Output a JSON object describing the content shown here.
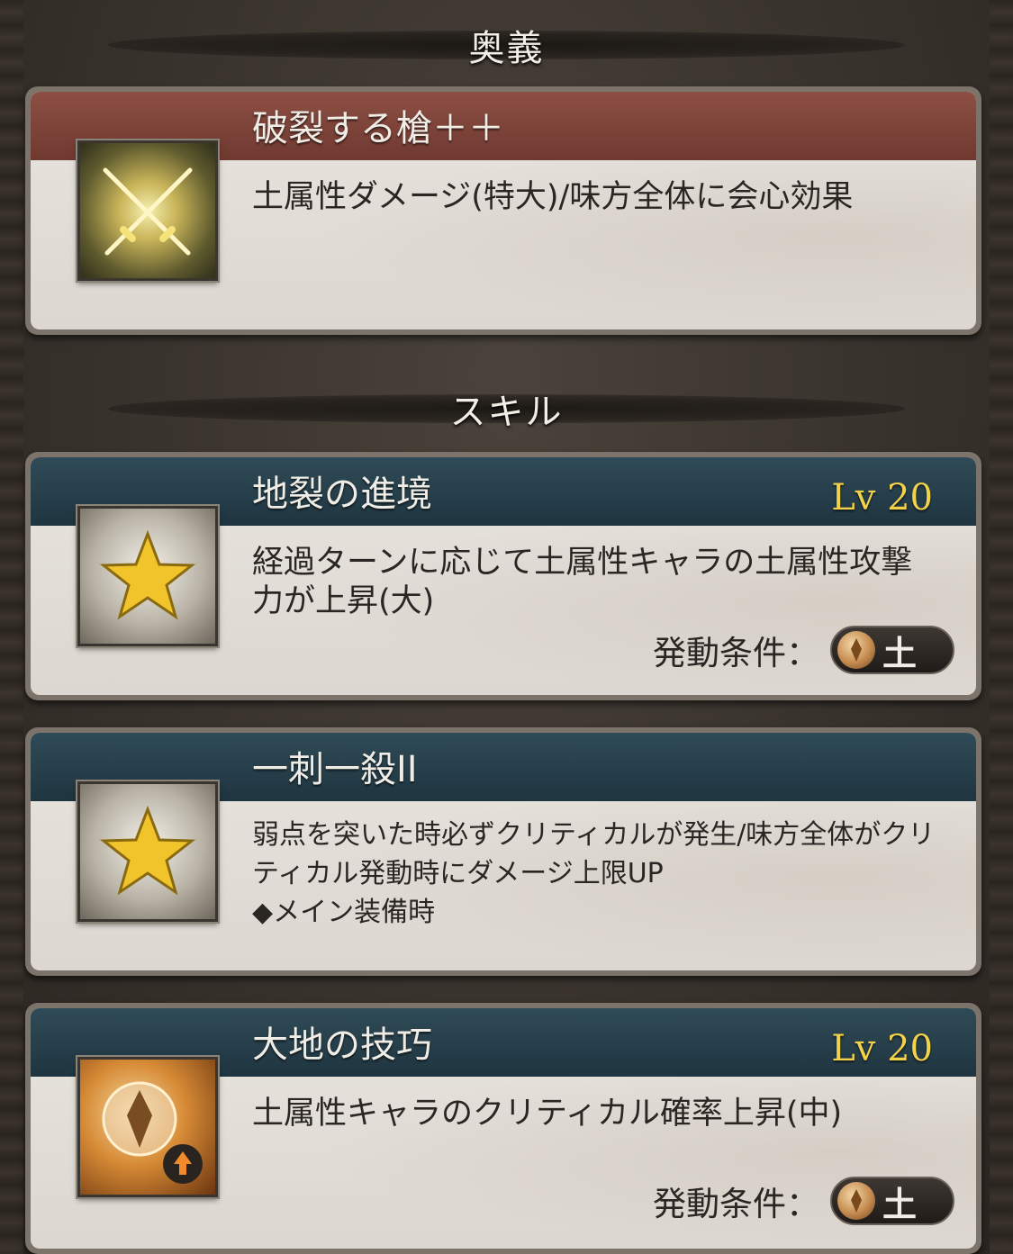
{
  "sections": {
    "ougi_header": "奥義",
    "skill_header": "スキル"
  },
  "ougi": {
    "title": "破裂する槍＋＋",
    "description": "土属性ダメージ(特大)/味方全体に会心効果",
    "icon": "crossed-swords-icon"
  },
  "skills": [
    {
      "title": "地裂の進境",
      "level": "Lv 20",
      "description": "経過ターンに応じて土属性キャラの土属性攻撃力が上昇(大)",
      "icon": "star-icon",
      "condition_label": "発動条件：",
      "condition_element": "土"
    },
    {
      "title": "一刺一殺II",
      "description_line1": "弱点を突いた時必ずクリティカルが発生/味方全体がクリティカル発動時にダメージ上限UP",
      "description_line2": "◆メイン装備時",
      "icon": "star-icon"
    },
    {
      "title": "大地の技巧",
      "level": "Lv 20",
      "description": "土属性キャラのクリティカル確率上昇(中)",
      "icon": "earth-critical-icon",
      "condition_label": "発動条件：",
      "condition_element": "土"
    }
  ],
  "colors": {
    "ougi_band": "#7d4438",
    "skill_band": "#28424e",
    "level_text": "#f3d24a",
    "card_body": "#e2ded8"
  }
}
